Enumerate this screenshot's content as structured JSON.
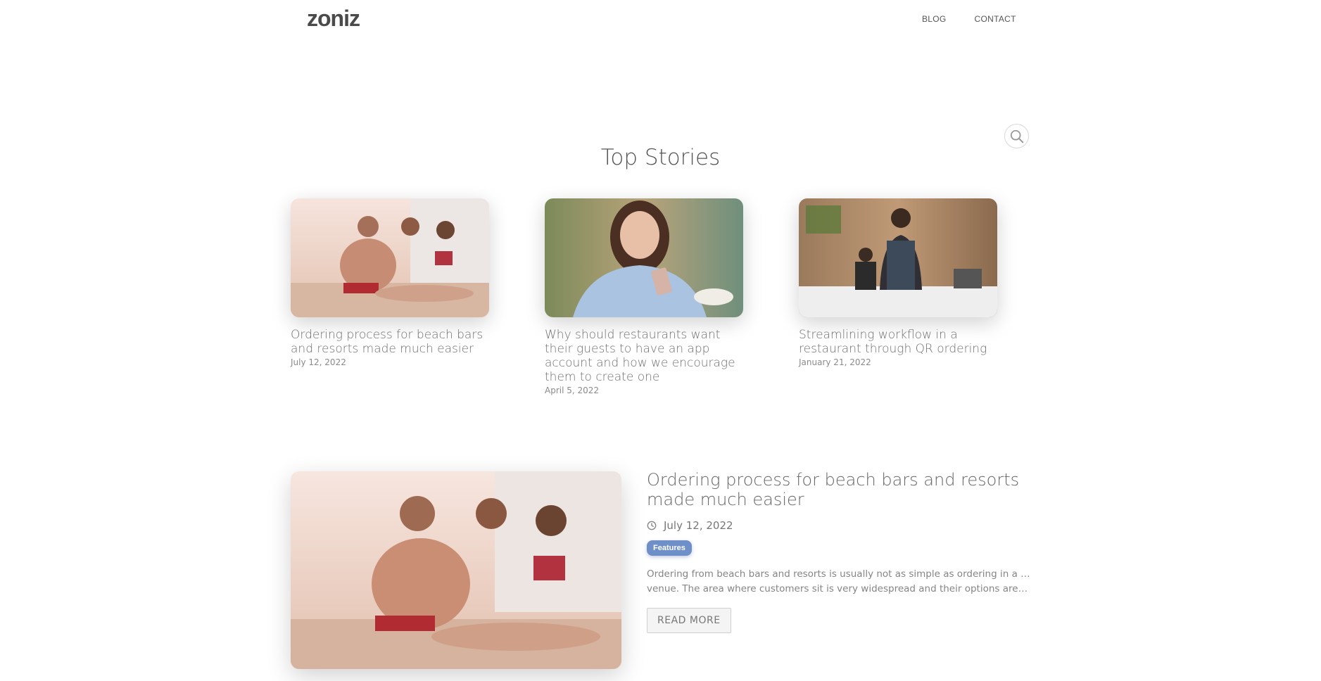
{
  "header": {
    "logo": "zoniz",
    "nav": [
      "BLOG",
      "CONTACT"
    ]
  },
  "search": {
    "icon": "search-icon"
  },
  "top_stories": {
    "title": "Top Stories",
    "cards": [
      {
        "title": "Ordering process for beach bars and resorts made much easier",
        "date": "July 12, 2022",
        "image": "beach-bar-friends-photo"
      },
      {
        "title": "Why should restaurants want their guests to have an app account and how we encourage them to create one",
        "date": "April 5, 2022",
        "image": "woman-with-phone-photo"
      },
      {
        "title": "Streamlining workflow in a restaurant through QR ordering",
        "date": "January 21, 2022",
        "image": "barista-cafe-photo"
      }
    ]
  },
  "featured": {
    "title": "Ordering process for beach bars and resorts made much easier",
    "date": "July 12, 2022",
    "tag": "Features",
    "excerpt_line1": "Ordering from beach bars and resorts is usually not as simple as ordering in a classic",
    "excerpt_line2": "venue. The area where customers sit is very widespread and their options are either...",
    "read_more": "READ MORE",
    "image": "beach-bar-friends-photo"
  },
  "colors": {
    "badge": "#6e8fc8",
    "text": "#6b6b6b"
  }
}
